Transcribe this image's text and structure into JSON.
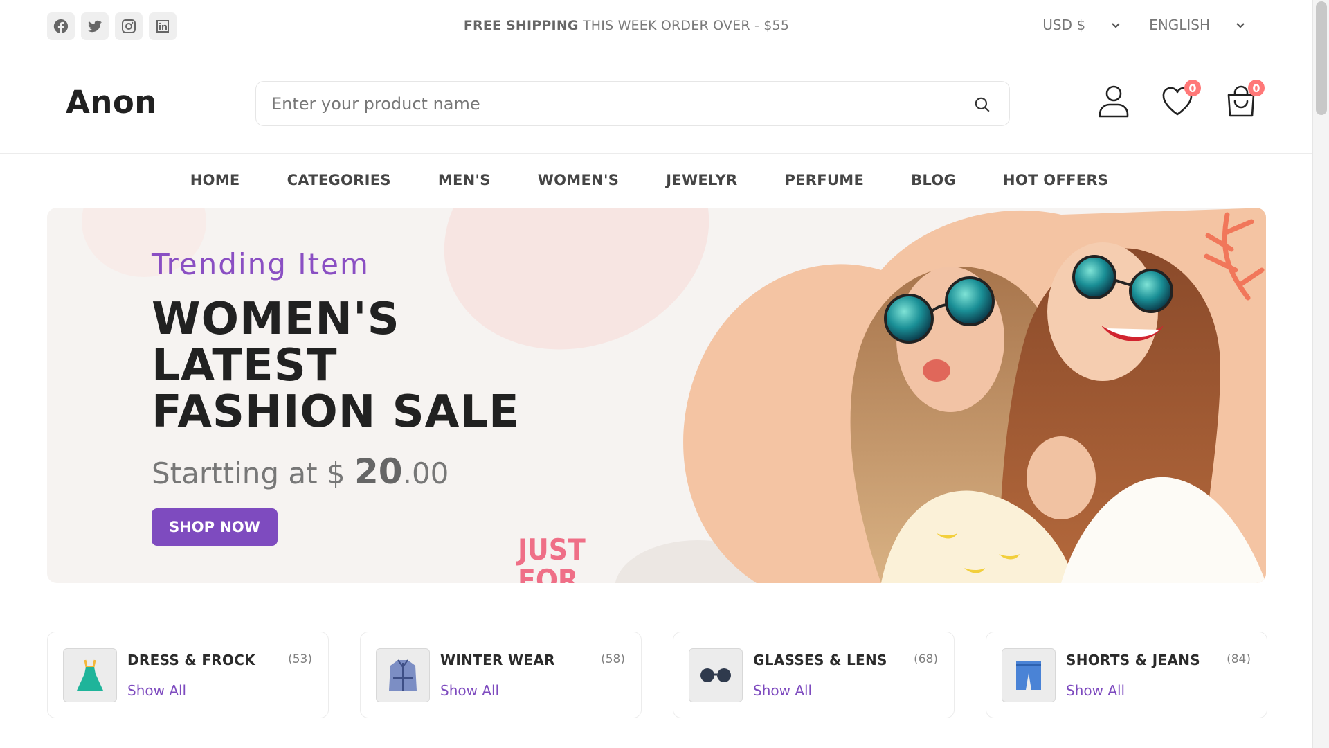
{
  "topbar": {
    "social": [
      "facebook-icon",
      "twitter-icon",
      "instagram-icon",
      "linkedin-icon"
    ],
    "announce_bold": "FREE SHIPPING",
    "announce_rest": "THIS WEEK ORDER OVER - $55",
    "currency": "USD $",
    "language": "ENGLISH"
  },
  "header": {
    "logo": "Anon",
    "search_placeholder": "Enter your product name",
    "wishlist_count": "0",
    "cart_count": "0"
  },
  "nav": [
    "HOME",
    "CATEGORIES",
    "MEN'S",
    "WOMEN'S",
    "JEWELYR",
    "PERFUME",
    "BLOG",
    "HOT OFFERS"
  ],
  "hero": {
    "kicker": "Trending Item",
    "headline_lines": [
      "WOMEN'S",
      "LATEST",
      "FASHION SALE"
    ],
    "price_prefix": "Startting at $ ",
    "price_whole": "20",
    "price_cents": ".00",
    "button": "SHOP NOW",
    "deco_lines": [
      "JUST",
      "FOR"
    ]
  },
  "categories": [
    {
      "name": "DRESS & FROCK",
      "count": "(53)",
      "link": "Show All",
      "icon": "dress-icon"
    },
    {
      "name": "WINTER WEAR",
      "count": "(58)",
      "link": "Show All",
      "icon": "coat-icon"
    },
    {
      "name": "GLASSES & LENS",
      "count": "(68)",
      "link": "Show All",
      "icon": "glasses-icon"
    },
    {
      "name": "SHORTS & JEANS",
      "count": "(84)",
      "link": "Show All",
      "icon": "shorts-icon"
    }
  ],
  "colors": {
    "accent": "#7e4bbf",
    "badge": "#ff7878",
    "kicker": "#8a4fc3",
    "hero_bg": "#f6f3f1"
  }
}
